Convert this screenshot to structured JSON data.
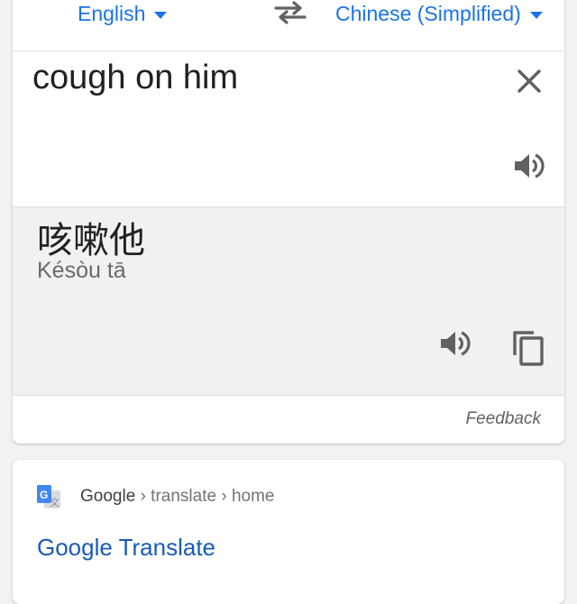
{
  "translator": {
    "source_language": "English",
    "target_language": "Chinese (Simplified)",
    "source_text": "cough on him",
    "translated_text": "咳嗽他",
    "romanization": "Késòu tā",
    "feedback_label": "Feedback"
  },
  "search_result": {
    "site_name": "Google",
    "path_1": "translate",
    "path_2": "home",
    "separator": "›",
    "title": "Google Translate"
  },
  "icons": {
    "swap": "swap-arrows-icon",
    "clear": "close-icon",
    "speak": "speaker-icon",
    "copy": "copy-icon",
    "favicon": "google-translate-favicon"
  },
  "colors": {
    "accent": "#1a73e8",
    "link": "#1a5bb8",
    "icon": "#616161",
    "output_background": "#f1f1f1"
  }
}
